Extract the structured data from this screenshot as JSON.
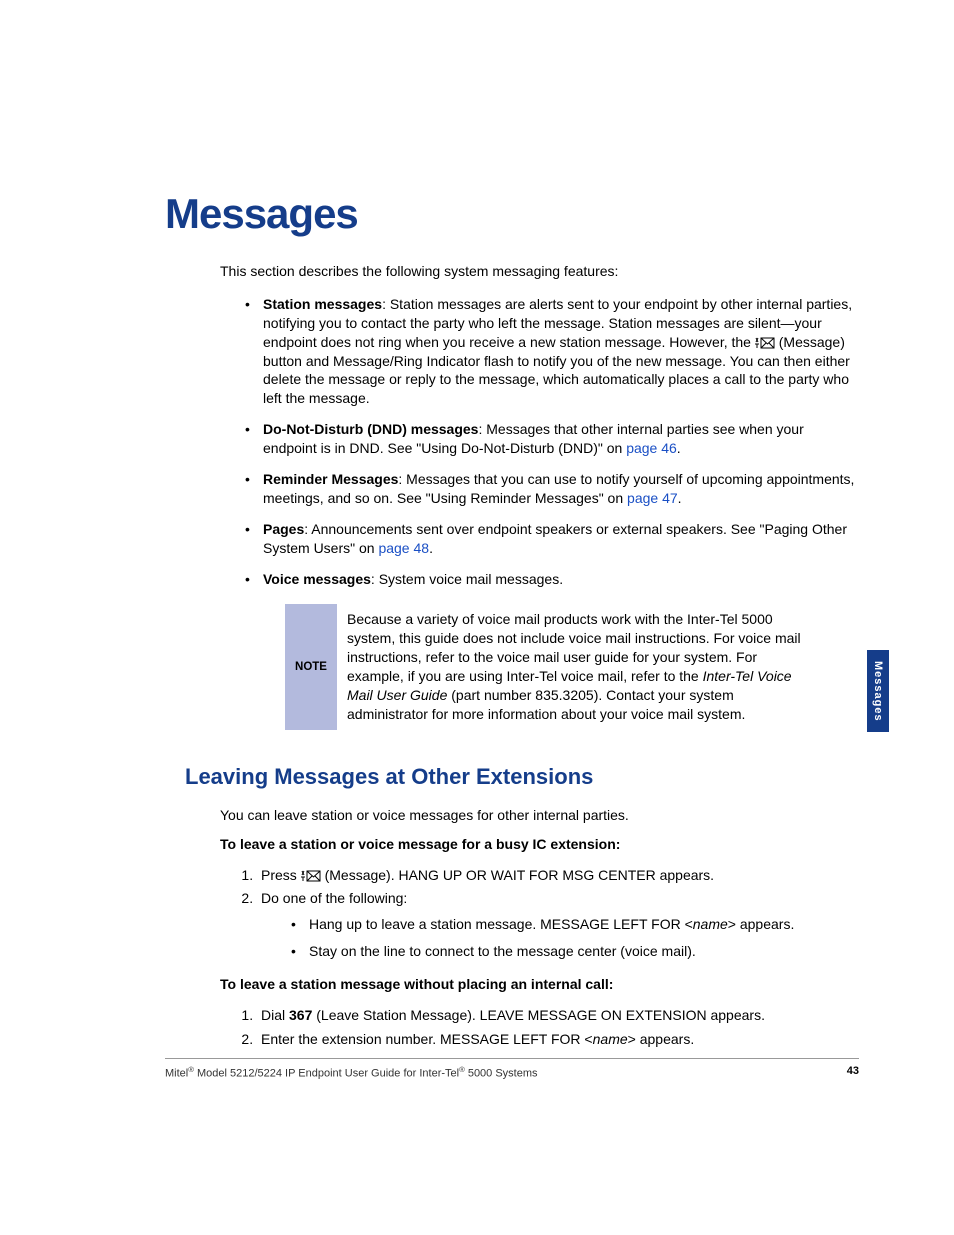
{
  "chapter_title": "Messages",
  "intro": "This section describes the following system messaging features:",
  "bullets": {
    "station": {
      "label": "Station messages",
      "pre": ": Station messages are alerts sent to your endpoint by other internal parties, notifying you to contact the party who left the message. Station messages are silent—your endpoint does not ring when you receive a new station message. However, the ",
      "post": " (Message) button and Message/Ring Indicator flash to notify you of the new message. You can then either delete the message or reply to the message, which automatically places a call to the party who left the message."
    },
    "dnd": {
      "label": "Do-Not-Disturb (DND) messages",
      "text": ": Messages that other internal parties see when your endpoint is in DND. See \"Using Do-Not-Disturb (DND)\" on ",
      "link": "page 46",
      "after": "."
    },
    "reminder": {
      "label": "Reminder Messages",
      "text": ": Messages that you can use to notify yourself of upcoming appointments, meetings, and so on. See \"Using Reminder Messages\" on ",
      "link": "page 47",
      "after": "."
    },
    "pages": {
      "label": "Pages",
      "text": ": Announcements sent over endpoint speakers or external speakers. See \"Paging Other System Users\" on ",
      "link": "page 48",
      "after": "."
    },
    "voice": {
      "label": "Voice messages",
      "text": ": System voice mail messages."
    }
  },
  "note": {
    "label": "NOTE",
    "pre": "Because a variety of voice mail products work with the Inter-Tel 5000 system, this guide does not include voice mail instructions. For voice mail instructions, refer to the voice mail user guide for your system. For example, if you are using Inter-Tel voice mail, refer to the ",
    "italic": "Inter-Tel Voice Mail User Guide",
    "post": " (part number 835.3205). Contact your system administrator for more information about your voice mail system."
  },
  "section_title": "Leaving Messages at Other Extensions",
  "body_line": "You can leave station or voice messages for other internal parties.",
  "proc1": {
    "head": "To leave a station or voice message for a busy IC extension:",
    "step1_pre": "Press ",
    "step1_post": " (Message). HANG UP OR WAIT FOR MSG CENTER appears.",
    "step2": "Do one of the following:",
    "sub1_pre": "Hang up to leave a station message. MESSAGE LEFT FOR <",
    "sub1_name": "name",
    "sub1_post": "> appears.",
    "sub2": "Stay on the line to connect to the message center (voice mail)."
  },
  "proc2": {
    "head": "To leave a station message without placing an internal call:",
    "step1_pre": "Dial ",
    "step1_code": "367",
    "step1_post": " (Leave Station Message). LEAVE MESSAGE ON EXTENSION appears.",
    "step2_pre": "Enter the extension number. MESSAGE LEFT FOR <",
    "step2_name": "name",
    "step2_post": "> appears."
  },
  "side_tab": "Messages",
  "footer": {
    "product_a": "Mitel",
    "product_b": " Model 5212/5224 IP Endpoint User Guide for Inter-Tel",
    "product_c": " 5000 Systems",
    "page": "43"
  }
}
